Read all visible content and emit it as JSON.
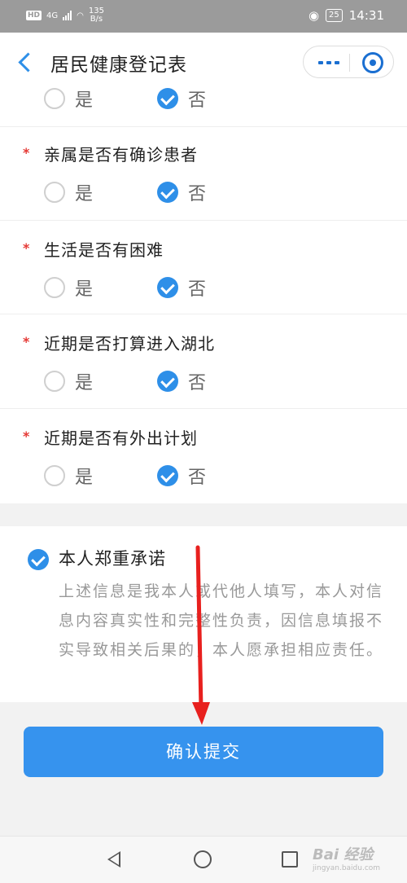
{
  "status_bar": {
    "hd": "HD",
    "network": "4G",
    "speed_value": "135",
    "speed_unit": "B/s",
    "battery": "25",
    "time": "14:31"
  },
  "header": {
    "title": "居民健康登记表"
  },
  "form": {
    "partial_row": {
      "yes": "是",
      "no": "否",
      "selected": "no"
    },
    "questions": [
      {
        "label": "亲属是否有确诊患者",
        "required": "*",
        "yes": "是",
        "no": "否",
        "selected": "no"
      },
      {
        "label": "生活是否有困难",
        "required": "*",
        "yes": "是",
        "no": "否",
        "selected": "no"
      },
      {
        "label": "近期是否打算进入湖北",
        "required": "*",
        "yes": "是",
        "no": "否",
        "selected": "no"
      },
      {
        "label": "近期是否有外出计划",
        "required": "*",
        "yes": "是",
        "no": "否",
        "selected": "no"
      }
    ]
  },
  "commitment": {
    "title": "本人郑重承诺",
    "checked": true,
    "text": "上述信息是我本人或代他人填写，本人对信息内容真实性和完整性负责，因信息填报不实导致相关后果的，本人愿承担相应责任。"
  },
  "submit": {
    "label": "确认提交"
  },
  "colors": {
    "accent": "#3693ee",
    "required_star": "#e53935",
    "annotation_arrow": "#e8201e"
  },
  "watermark": {
    "text": "Bai 经验",
    "sub": "jingyan.baidu.com"
  }
}
